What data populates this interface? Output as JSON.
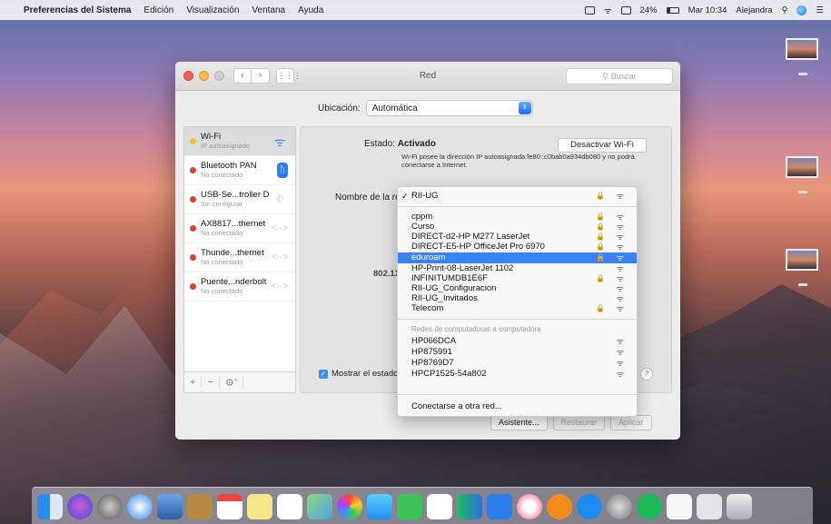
{
  "menubar": {
    "app": "Preferencias del Sistema",
    "items": [
      "Edición",
      "Visualización",
      "Ventana",
      "Ayuda"
    ],
    "battery": "24%",
    "clock": "Mar 10:34",
    "user": "Alejandra"
  },
  "window": {
    "title": "Red",
    "search_placeholder": "Buscar",
    "location_label": "Ubicación:",
    "location_value": "Automática"
  },
  "services": [
    {
      "name": "Wi-Fi",
      "status": "IP autoasignado",
      "dot": "yellow",
      "icon": "wifi-icon"
    },
    {
      "name": "Bluetooth PAN",
      "status": "No conectado",
      "dot": "red",
      "icon": "bluetooth-icon"
    },
    {
      "name": "USB-Se...troller D",
      "status": "Sin configurar",
      "dot": "red",
      "icon": "phone-icon"
    },
    {
      "name": "AX8817...thernet",
      "status": "No conectado",
      "dot": "red",
      "icon": "ethernet-icon"
    },
    {
      "name": "Thunde...thernet",
      "status": "No conectado",
      "dot": "red",
      "icon": "ethernet-icon"
    },
    {
      "name": "Puente...nderbolt",
      "status": "No conectado",
      "dot": "red",
      "icon": "ethernet-icon"
    }
  ],
  "panel": {
    "status_label": "Estado:",
    "status_value": "Activado",
    "deactivate_button": "Desactivar Wi-Fi",
    "description": "Wi-Fi posee la dirección IP autoasignada fe80::c0bab0a934db080 y no podrá conectarse a Internet.",
    "network_name_label": "Nombre de la red",
    "label_8021x": "802.1X",
    "show_status": "Mostrar el estado",
    "help": "?"
  },
  "menu": {
    "current": "RII-UG",
    "networks": [
      {
        "name": "cppm",
        "lock": true
      },
      {
        "name": "Curso",
        "lock": true
      },
      {
        "name": "DIRECT-d2-HP M277 LaserJet",
        "lock": true
      },
      {
        "name": "DIRECT-E5-HP OfficeJet Pro 6970",
        "lock": true
      },
      {
        "name": "eduroam",
        "lock": true,
        "selected": true
      },
      {
        "name": "HP-Print-08-LaserJet 1102",
        "lock": false
      },
      {
        "name": "INFINITUMDB1E6F",
        "lock": true
      },
      {
        "name": "RII-UG_Configuracion",
        "lock": false
      },
      {
        "name": "RII-UG_Invitados",
        "lock": false
      },
      {
        "name": "Telecom",
        "lock": true
      }
    ],
    "section_title": "Redes de computadoras a computadora",
    "computer_networks": [
      "HP066DCA",
      "HP875991",
      "HP8769D7",
      "HPCP1525-54a802"
    ],
    "join_other": "Conectarse a otra red..."
  },
  "buttons": {
    "assistant": "Asistente...",
    "revert": "Restaurar",
    "apply": "Aplicar"
  },
  "glyphs": {
    "apple": "",
    "lock": "🔒",
    "wifi": "ᯤ",
    "check": "✓",
    "chevron_up_down": "⇕"
  }
}
